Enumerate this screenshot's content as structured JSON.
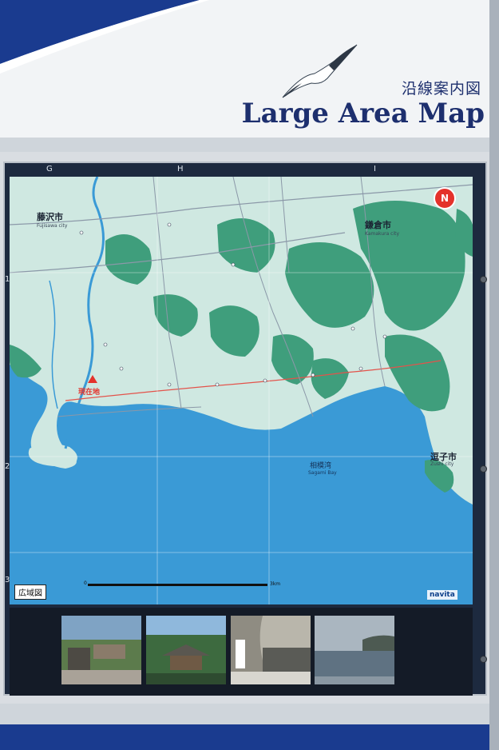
{
  "sign": {
    "title_jp": "沿線案内図",
    "title_en": "Large Area Map"
  },
  "grid": {
    "columns": [
      "G",
      "H",
      "I"
    ],
    "rows": [
      "1",
      "2",
      "3"
    ]
  },
  "map": {
    "compass": "N",
    "legend": "広域図",
    "scale_start": "0",
    "scale_end": "3km",
    "logo": "navita",
    "labels": {
      "fujisawa": "藤沢市",
      "fujisawa_en": "Fujisawa city",
      "kamakura": "鎌倉市",
      "kamakura_en": "Kamakura city",
      "zushi": "逗子市",
      "zushi_en": "Zushi city",
      "sagami_bay": "相模湾",
      "sagami_bay_en": "Sagami Bay",
      "current_location": "現在地"
    }
  },
  "photos": [
    {
      "name": "shrine-gate-photo"
    },
    {
      "name": "temple-roof-photo"
    },
    {
      "name": "cave-photo"
    },
    {
      "name": "coast-photo"
    }
  ],
  "colors": {
    "sea": "#3a9ad6",
    "land": "#cfe8e1",
    "forest": "#3f9e7c",
    "title": "#1d2f6e",
    "marker": "#e4322b"
  }
}
